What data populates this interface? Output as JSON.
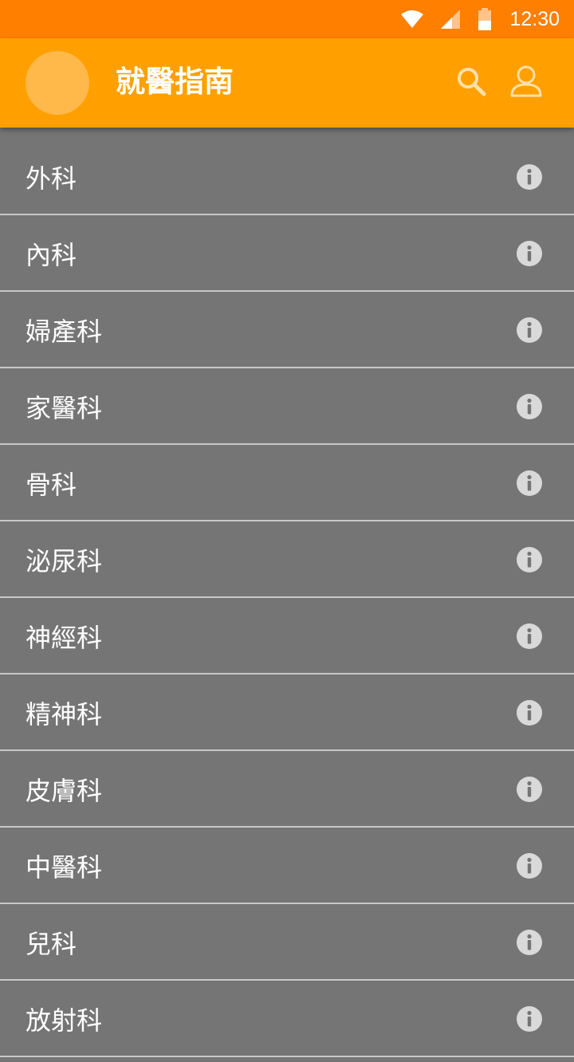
{
  "status_bar": {
    "time": "12:30",
    "icons": [
      "wifi-icon",
      "cell-signal-icon",
      "battery-icon"
    ]
  },
  "app_bar": {
    "title": "就醫指南",
    "actions": [
      "search-icon",
      "user-icon"
    ]
  },
  "departments": [
    {
      "label": "外科"
    },
    {
      "label": "內科"
    },
    {
      "label": "婦產科"
    },
    {
      "label": "家醫科"
    },
    {
      "label": "骨科"
    },
    {
      "label": "泌尿科"
    },
    {
      "label": "神經科"
    },
    {
      "label": "精神科"
    },
    {
      "label": "皮膚科"
    },
    {
      "label": "中醫科"
    },
    {
      "label": "兒科"
    },
    {
      "label": "放射科"
    }
  ],
  "colors": {
    "status_bar": "#FF7F00",
    "app_bar": "#FFA000",
    "list_background": "#757575",
    "divider": "#C8C8C8",
    "info_icon": "#D9D9D9"
  }
}
